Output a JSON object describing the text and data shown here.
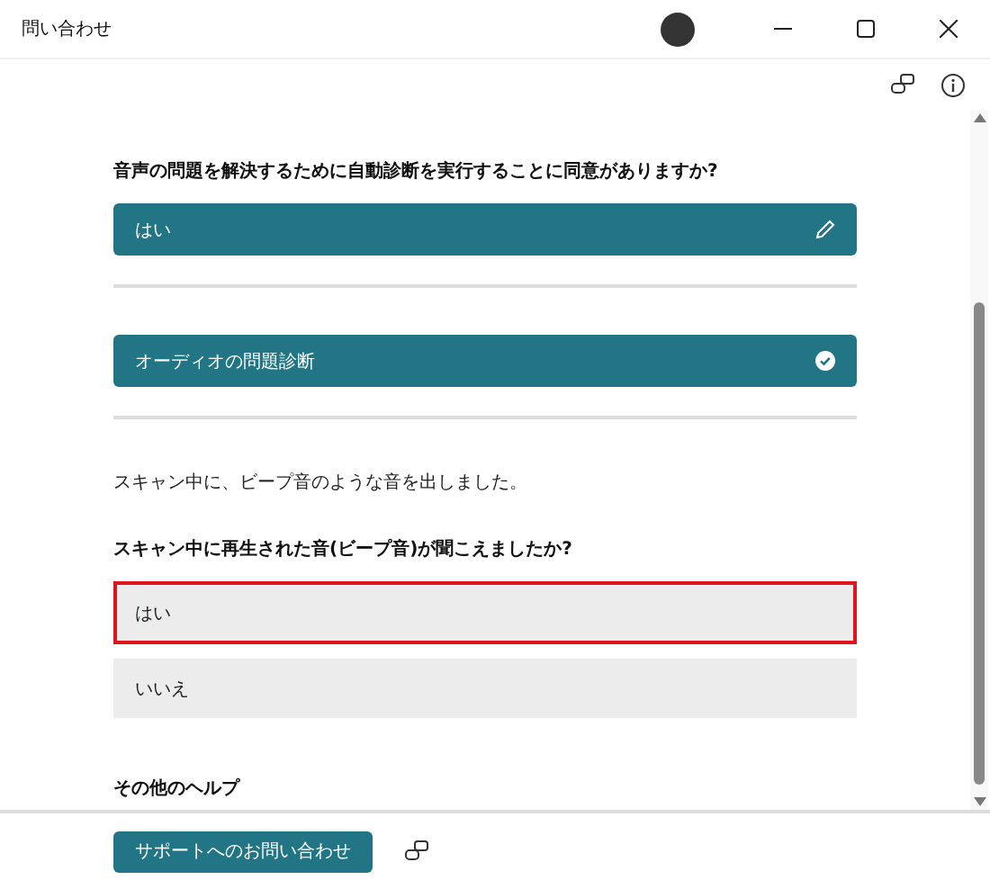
{
  "window": {
    "title": "問い合わせ"
  },
  "conversation": [
    {
      "kind": "question",
      "text": "音声の問題を解決するために自動診断を実行することに同意がありますか?"
    },
    {
      "kind": "answer",
      "text": "はい"
    },
    {
      "kind": "divider"
    },
    {
      "kind": "step",
      "text": "オーディオの問題診断"
    },
    {
      "kind": "divider"
    },
    {
      "kind": "message",
      "text": "スキャン中に、ビープ音のような音を出しました。"
    },
    {
      "kind": "question",
      "text": "スキャン中に再生された音(ビープ音)が聞こえましたか?"
    },
    {
      "kind": "options",
      "options": [
        {
          "label": "はい",
          "selected": true
        },
        {
          "label": "いいえ",
          "selected": false
        }
      ]
    },
    {
      "kind": "heading",
      "text": "その他のヘルプ"
    }
  ],
  "footer": {
    "button": "サポートへのお問い合わせ"
  }
}
